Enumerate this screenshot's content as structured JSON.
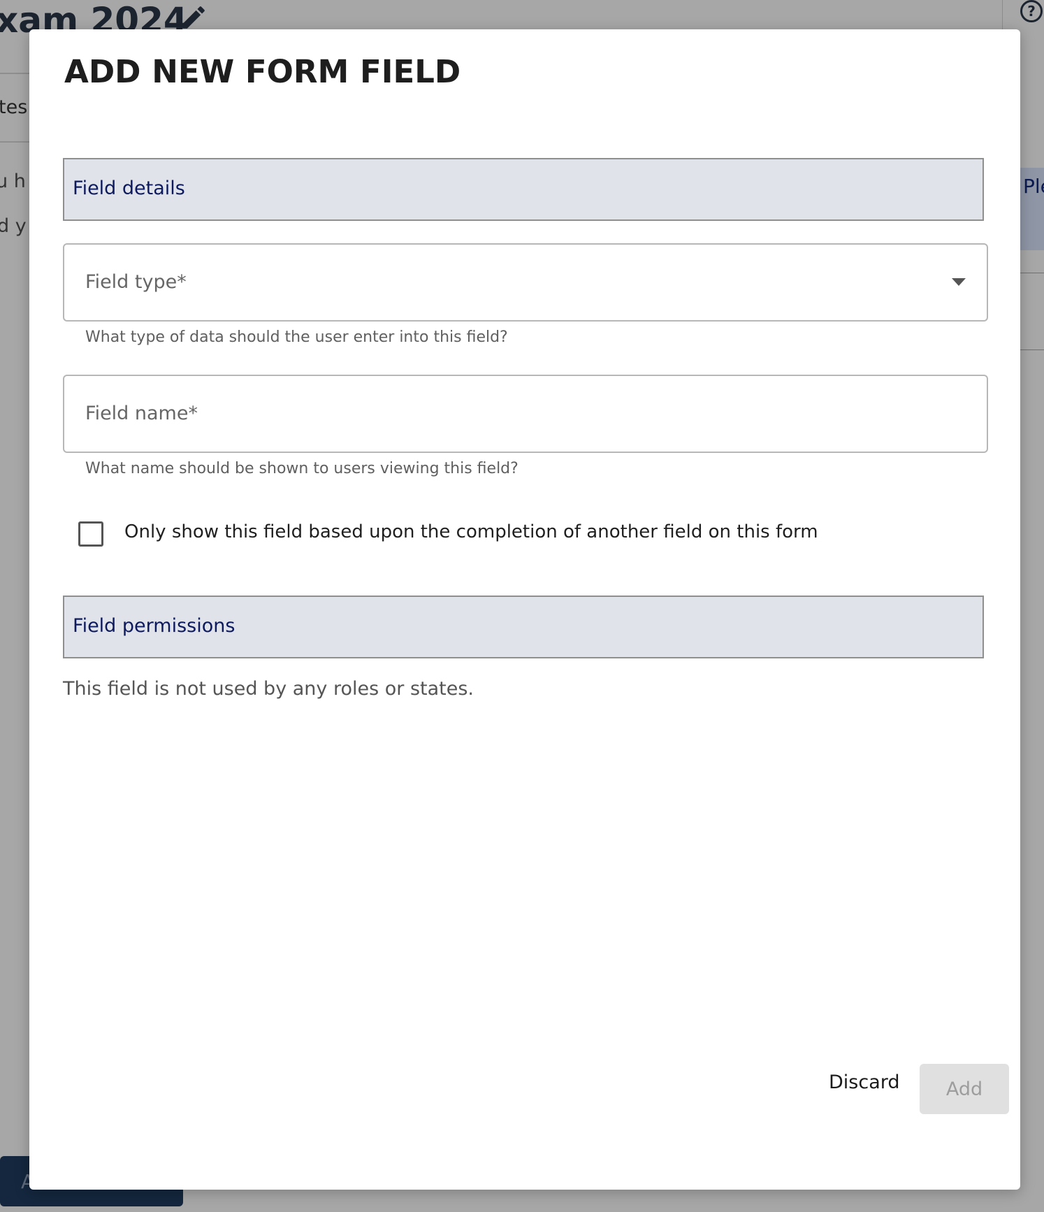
{
  "background": {
    "page_title": "xam 2024",
    "tab_text": "tes",
    "line1": "u h",
    "line2": "d y",
    "right_panel_text": "Ple",
    "apply_button": "A"
  },
  "modal": {
    "title": "ADD NEW FORM FIELD",
    "sections": {
      "details_header": "Field details",
      "permissions_header": "Field permissions"
    },
    "field_type": {
      "label": "Field type*",
      "value": "",
      "helper": "What type of data should the user enter into this field?"
    },
    "field_name": {
      "label": "Field name*",
      "value": "",
      "helper": "What name should be shown to users viewing this field?"
    },
    "conditional_checkbox": {
      "label": "Only show this field based upon the completion of another field on this form",
      "checked": false
    },
    "permissions_note": "This field is not used by any roles or states.",
    "actions": {
      "discard_label": "Discard",
      "add_label": "Add"
    }
  },
  "colors": {
    "section_header_bg": "#e0e3ea",
    "section_header_text": "#0e1a5e",
    "add_button_disabled_bg": "#e0e0e0"
  }
}
